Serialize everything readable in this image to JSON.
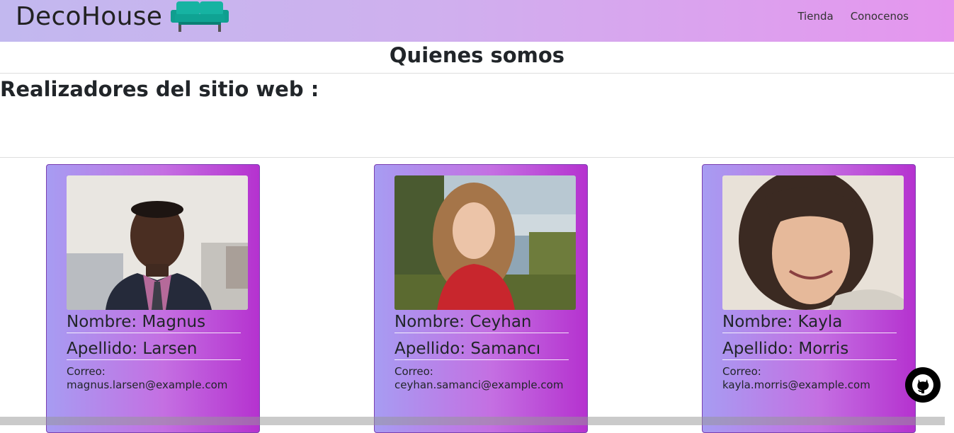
{
  "brand": {
    "name": "DecoHouse",
    "logo_icon": "sofa-icon",
    "logo_color": "#12b3a3"
  },
  "nav": {
    "items": [
      "Tienda",
      "Conocenos"
    ]
  },
  "page": {
    "title": "Quienes somos",
    "section_title": "Realizadores del sitio web :"
  },
  "team": [
    {
      "first_label": "Nombre: Magnus",
      "last_label": "Apellido: Larsen",
      "email_label": "Correo:",
      "email": "magnus.larsen@example.com",
      "photo": "portrait of man in suit"
    },
    {
      "first_label": "Nombre: Ceyhan",
      "last_label": "Apellido: Samancı",
      "email_label": "Correo:",
      "email": "ceyhan.samanci@example.com",
      "photo": "portrait of woman in red blouse"
    },
    {
      "first_label": "Nombre: Kayla",
      "last_label": "Apellido: Morris",
      "email_label": "Correo:",
      "email": "kayla.morris@example.com",
      "photo": "portrait of smiling woman"
    }
  ],
  "floating": {
    "icon": "github-icon"
  }
}
